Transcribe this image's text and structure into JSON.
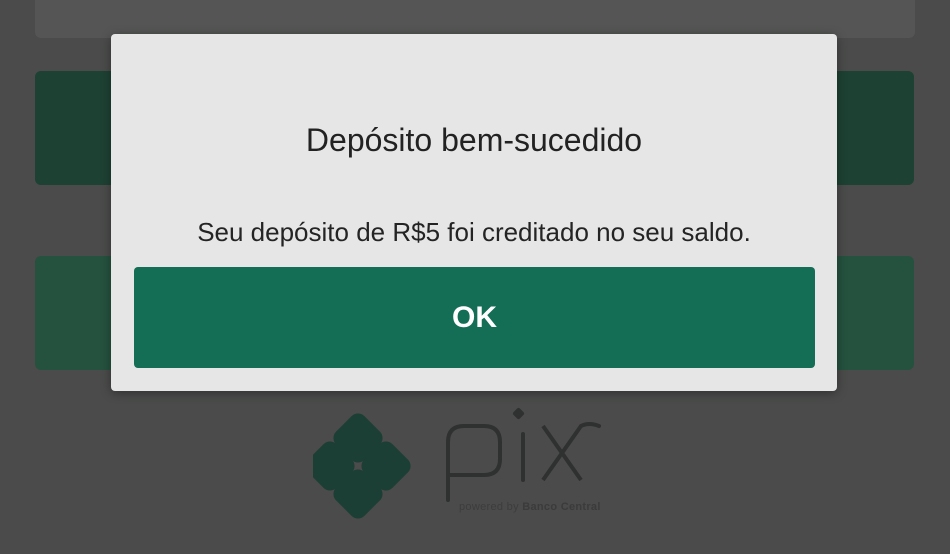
{
  "dialog": {
    "title": "Depósito bem-sucedido",
    "message": "Seu depósito de R$5 foi creditado no seu saldo.",
    "ok_label": "OK"
  },
  "logo": {
    "wordmark": "pix",
    "tagline_prefix": "powered by",
    "tagline_brand": "Banco Central"
  },
  "colors": {
    "overlay_background": "#4a4b4a",
    "dialog_background": "#e6e6e6",
    "primary_button": "#136e55",
    "pix_logo": "#1b3f35"
  }
}
